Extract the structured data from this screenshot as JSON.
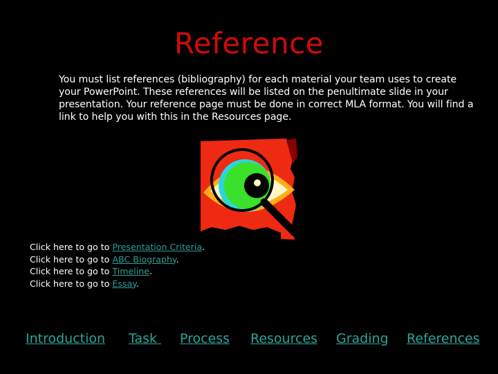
{
  "slide": {
    "title": "Reference",
    "title_color": "#d10a0a",
    "intro_text": "You must list references (bibliography) for each material your team uses to create your PowerPoint. These references will be listed on the penultimate slide in your presentation. Your reference page must be done in correct MLA format. You will find a link to help you with this in the Resources page.",
    "clipart": "eye-magnifying-glass-icon"
  },
  "links": [
    {
      "prefix": "Click here to go to ",
      "label": "Presentation Criteria",
      "suffix": "."
    },
    {
      "prefix": "Click here to go to ",
      "label": "ABC Biography",
      "suffix": "."
    },
    {
      "prefix": "Click here to go to ",
      "label": "Timeline",
      "suffix": "."
    },
    {
      "prefix": "Click here to go to ",
      "label": "Essay",
      "suffix": "."
    }
  ],
  "nav": {
    "link_color": "#2aa59a",
    "items": [
      {
        "label": "Introduction"
      },
      {
        "label": "Task "
      },
      {
        "label": "Process"
      },
      {
        "label": "Resources"
      },
      {
        "label": "Grading"
      },
      {
        "label": "References"
      }
    ]
  }
}
